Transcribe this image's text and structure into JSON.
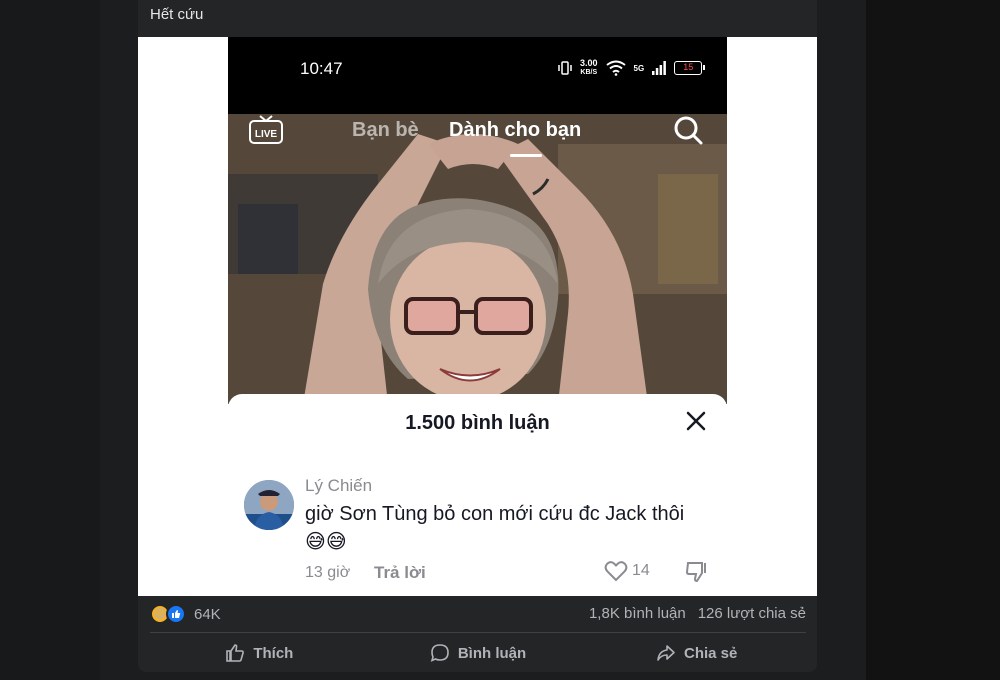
{
  "post": {
    "caption": "Hết cứu"
  },
  "phone": {
    "time": "10:47",
    "net_speed_value": "3.00",
    "net_speed_unit": "KB/S",
    "network_label": "5G",
    "battery": "15",
    "tabs": {
      "live": "LIVE",
      "friends": "Bạn bè",
      "for_you": "Dành cho bạn"
    },
    "sheet": {
      "title": "1.500 bình luận",
      "comment": {
        "username": "Lý Chiến",
        "text": "giờ Sơn Tùng bỏ con mới cứu đc Jack thôi",
        "emoji": "😅😅",
        "time": "13 giờ",
        "reply_label": "Trả lời",
        "likes": "14"
      }
    }
  },
  "stats": {
    "reaction_count": "64K",
    "comments": "1,8K bình luận",
    "shares": "126 lượt chia sẻ"
  },
  "actions": {
    "like": "Thích",
    "comment": "Bình luận",
    "share": "Chia sẻ"
  },
  "icons": {
    "live": "live-tv-icon",
    "search": "search-icon",
    "close": "close-icon",
    "heart": "heart-icon",
    "dislike": "dislike-icon",
    "like": "thumbs-up-icon",
    "comment": "comment-bubble-icon",
    "share": "share-arrow-icon"
  },
  "colors": {
    "facebook_blue": "#1877f2",
    "haha_yellow": "#f7b125",
    "battery_low": "#ff4d4f"
  }
}
